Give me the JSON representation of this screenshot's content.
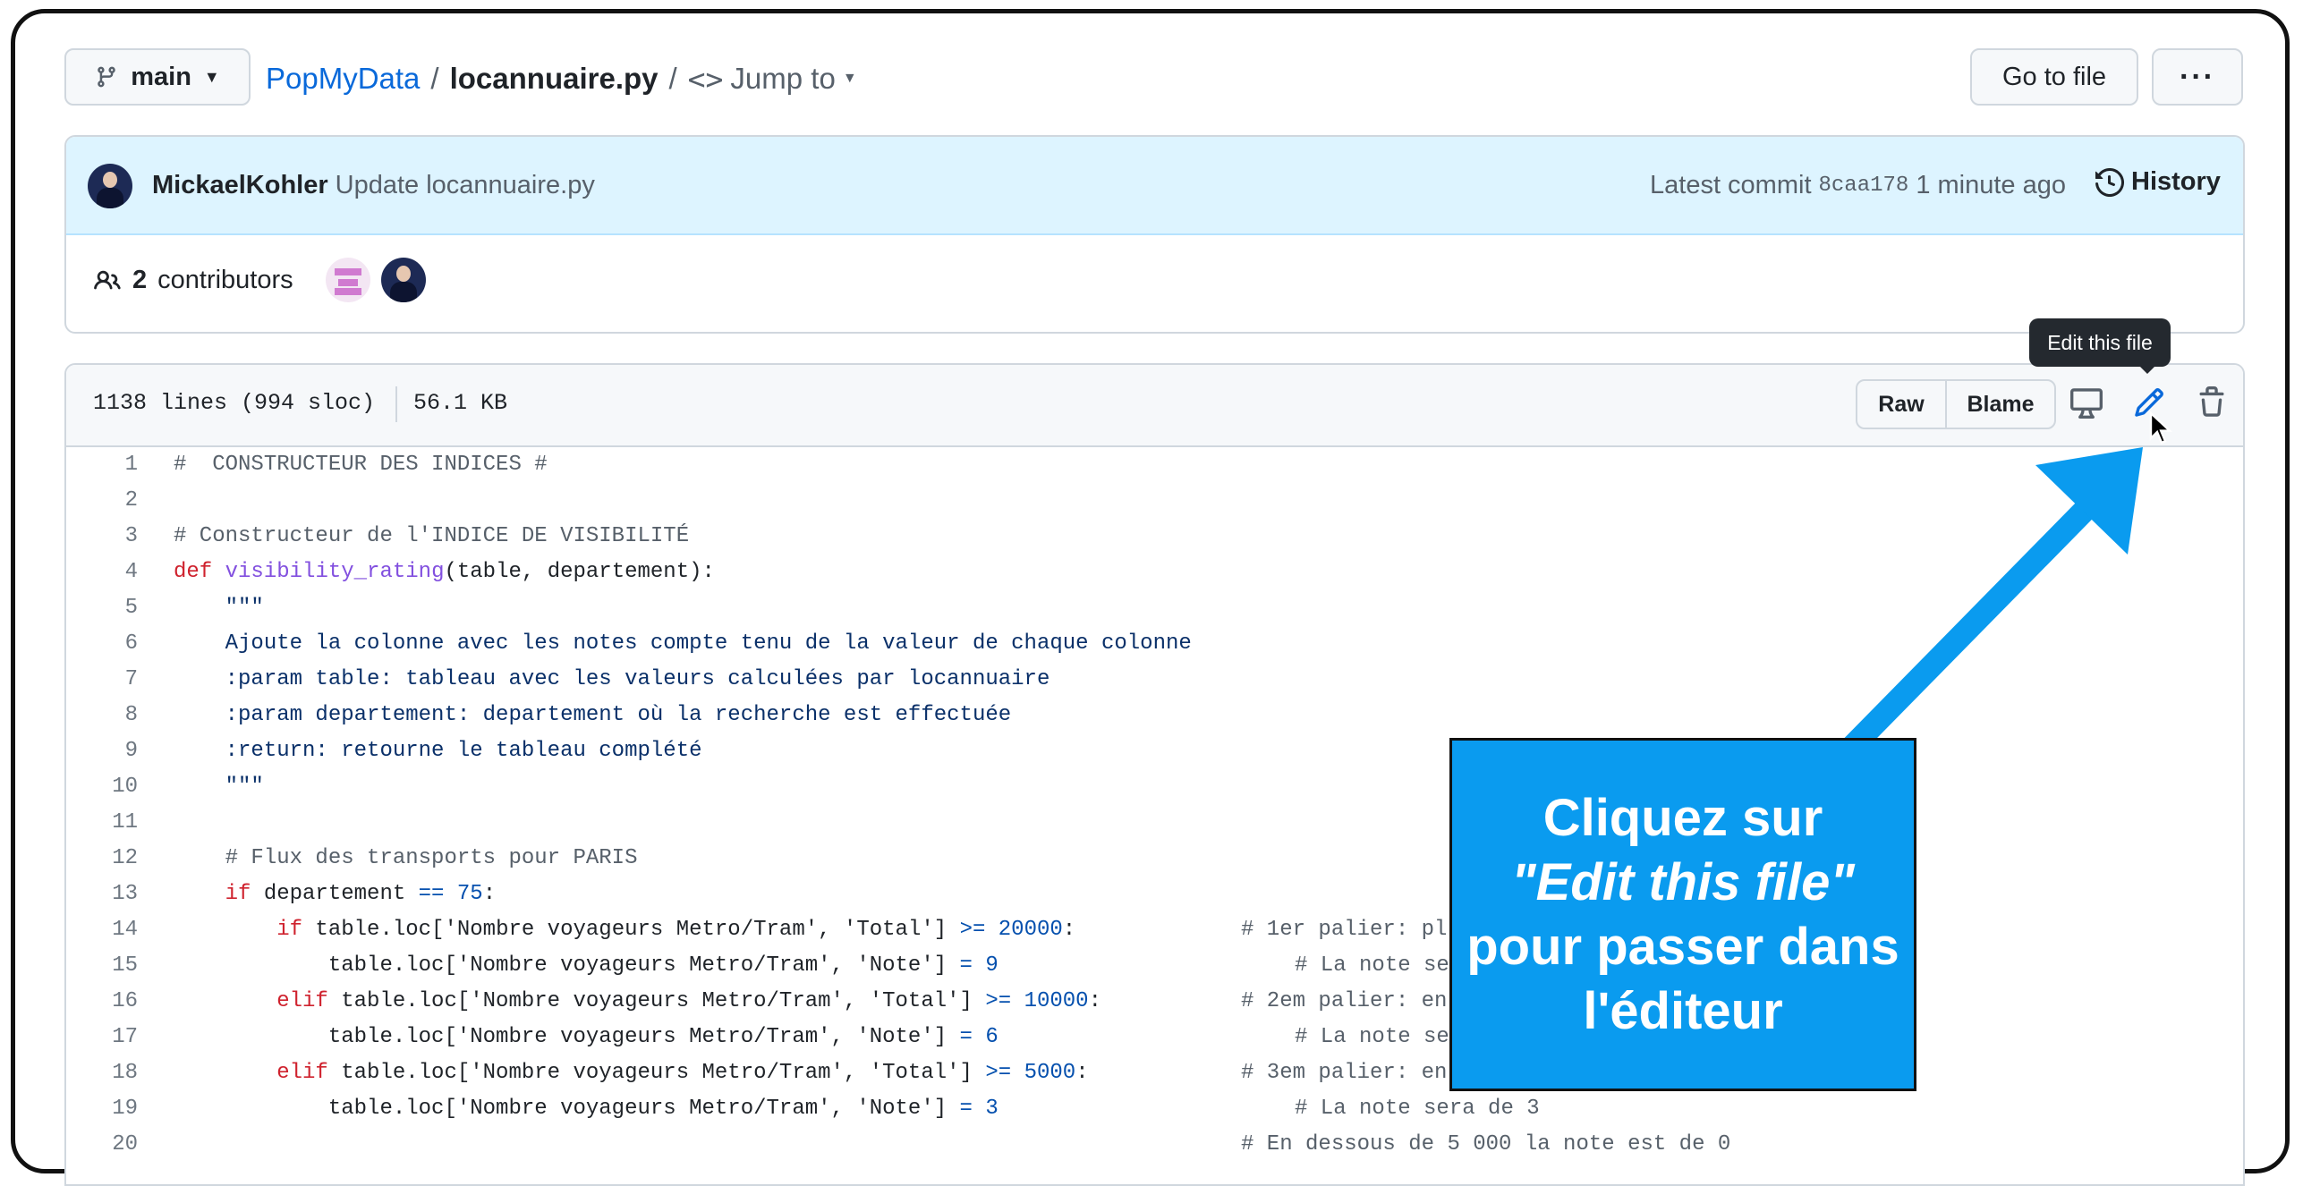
{
  "branch": {
    "label": "main"
  },
  "breadcrumb": {
    "repo": "PopMyData",
    "separator": "/",
    "file": "locannuaire.py",
    "jump_to": "Jump to"
  },
  "header_actions": {
    "goto_file": "Go to file",
    "more": "···"
  },
  "commit": {
    "author": "MickaelKohler",
    "message": "Update locannuaire.py",
    "latest_commit_label": "Latest commit",
    "sha": "8caa178",
    "time": "1 minute ago",
    "history": "History"
  },
  "contributors": {
    "count": "2",
    "label": "contributors"
  },
  "file_info": {
    "lines": "1138 lines (994 sloc)",
    "size": "56.1 KB"
  },
  "file_actions": {
    "raw": "Raw",
    "blame": "Blame",
    "tooltip": "Edit this file"
  },
  "code": {
    "line_numbers": [
      "1",
      "2",
      "3",
      "4",
      "5",
      "6",
      "7",
      "8",
      "9",
      "10",
      "11",
      "12",
      "13",
      "14",
      "15",
      "16",
      "17",
      "18",
      "19",
      "20"
    ],
    "l1": "#  CONSTRUCTEUR DES INDICES #",
    "l3": "# Constructeur de l'INDICE DE VISIBILITÉ",
    "l4_def": "def",
    "l4_fn": "visibility_rating",
    "l4_args": "(table, departement):",
    "l5": "    \"\"\"",
    "l6": "    Ajoute la colonne avec les notes compte tenu de la valeur de chaque colonne",
    "l7": "    :param table: tableau avec les valeurs calculées par locannuaire",
    "l8": "    :param departement: departement où la recherche est effectuée",
    "l9": "    :return: retourne le tableau complété",
    "l10": "    \"\"\"",
    "l12": "    # Flux des transports pour PARIS",
    "l13_if": "    if",
    "l13_rest": " departement ",
    "l13_op": "==",
    "l13_num": " 75",
    "l13_end": ":",
    "l14_kw": "        if",
    "l14_a": " table.loc['Nombre voyageurs Metro/Tram', 'Total'] ",
    "l14_op": ">=",
    "l14_num": " 20000",
    "l14_end": ":",
    "l14_cm": "# 1er palier: pl",
    "l15_a": "            table.loc['Nombre voyageurs Metro/Tram', 'Note'] ",
    "l15_op": "=",
    "l15_num": " 9",
    "l15_cm": "# La note se",
    "l16_kw": "        elif",
    "l16_a": " table.loc['Nombre voyageurs Metro/Tram', 'Total'] ",
    "l16_op": ">=",
    "l16_num": " 10000",
    "l16_end": ":",
    "l16_cm": "# 2em palier: en",
    "l17_a": "            table.loc['Nombre voyageurs Metro/Tram', 'Note'] ",
    "l17_op": "=",
    "l17_num": " 6",
    "l17_cm": "# La note se",
    "l18_kw": "        elif",
    "l18_a": " table.loc['Nombre voyageurs Metro/Tram', 'Total'] ",
    "l18_op": ">=",
    "l18_num": " 5000",
    "l18_end": ":",
    "l18_cm": "# 3em palier: en",
    "l19_a": "            table.loc['Nombre voyageurs Metro/Tram', 'Note'] ",
    "l19_op": "=",
    "l19_num": " 3",
    "l19_cm": "# La note sera de 3",
    "l20_cm": "# En dessous de 5 000 la note est de 0"
  },
  "callout": {
    "line1": "Cliquez sur",
    "line2": "\"Edit this file\"",
    "line3": "pour passer dans",
    "line4": "l'éditeur"
  },
  "colors": {
    "accent": "#0969da",
    "callout": "#0a9bef",
    "arrow": "#0a9bef"
  }
}
